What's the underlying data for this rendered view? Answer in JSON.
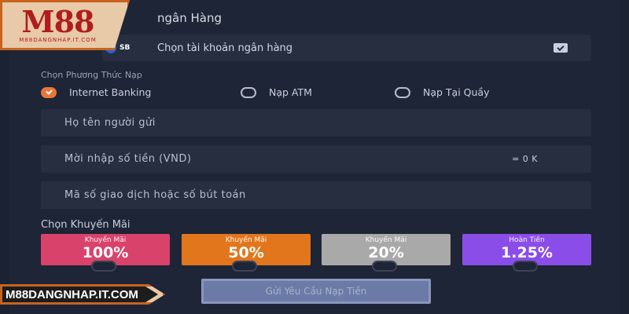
{
  "logo": {
    "text": "M88",
    "subtext": "M88DANGNHAP.IT.COM"
  },
  "bank": {
    "section_title": "ngân Hàng",
    "logo_text": "SB",
    "select_placeholder": "Chọn tài khoản ngân hàng",
    "caret_icon": "chevron-down-icon"
  },
  "method": {
    "label": "Chọn Phương Thức Nạp",
    "options": [
      {
        "label": "Internet Banking",
        "checked": true
      },
      {
        "label": "Nạp ATM",
        "checked": false
      },
      {
        "label": "Nạp Tại Quầy",
        "checked": false
      }
    ]
  },
  "fields": {
    "sender_name": "Họ tên người gửi",
    "amount": "Mời nhập số tiền (VND)",
    "amount_suffix": "= 0 K",
    "transaction_code": "Mã số giao dịch hoặc số bút toán"
  },
  "promo": {
    "label": "Chọn Khuyến Mãi",
    "items": [
      {
        "name": "Khuyến Mãi",
        "value": "100%",
        "color": "#d8426b"
      },
      {
        "name": "Khuyến Mãi",
        "value": "50%",
        "color": "#e2761c"
      },
      {
        "name": "Khuyến Mãi",
        "value": "20%",
        "color": "#a9a9a9"
      },
      {
        "name": "Hoàn Tiền",
        "value": "1.25%",
        "color": "#8b4de8"
      }
    ]
  },
  "submit_label": "Gửi Yêu Cầu Nạp Tiền",
  "site_banner": "M88DANGNHAP.IT.COM"
}
